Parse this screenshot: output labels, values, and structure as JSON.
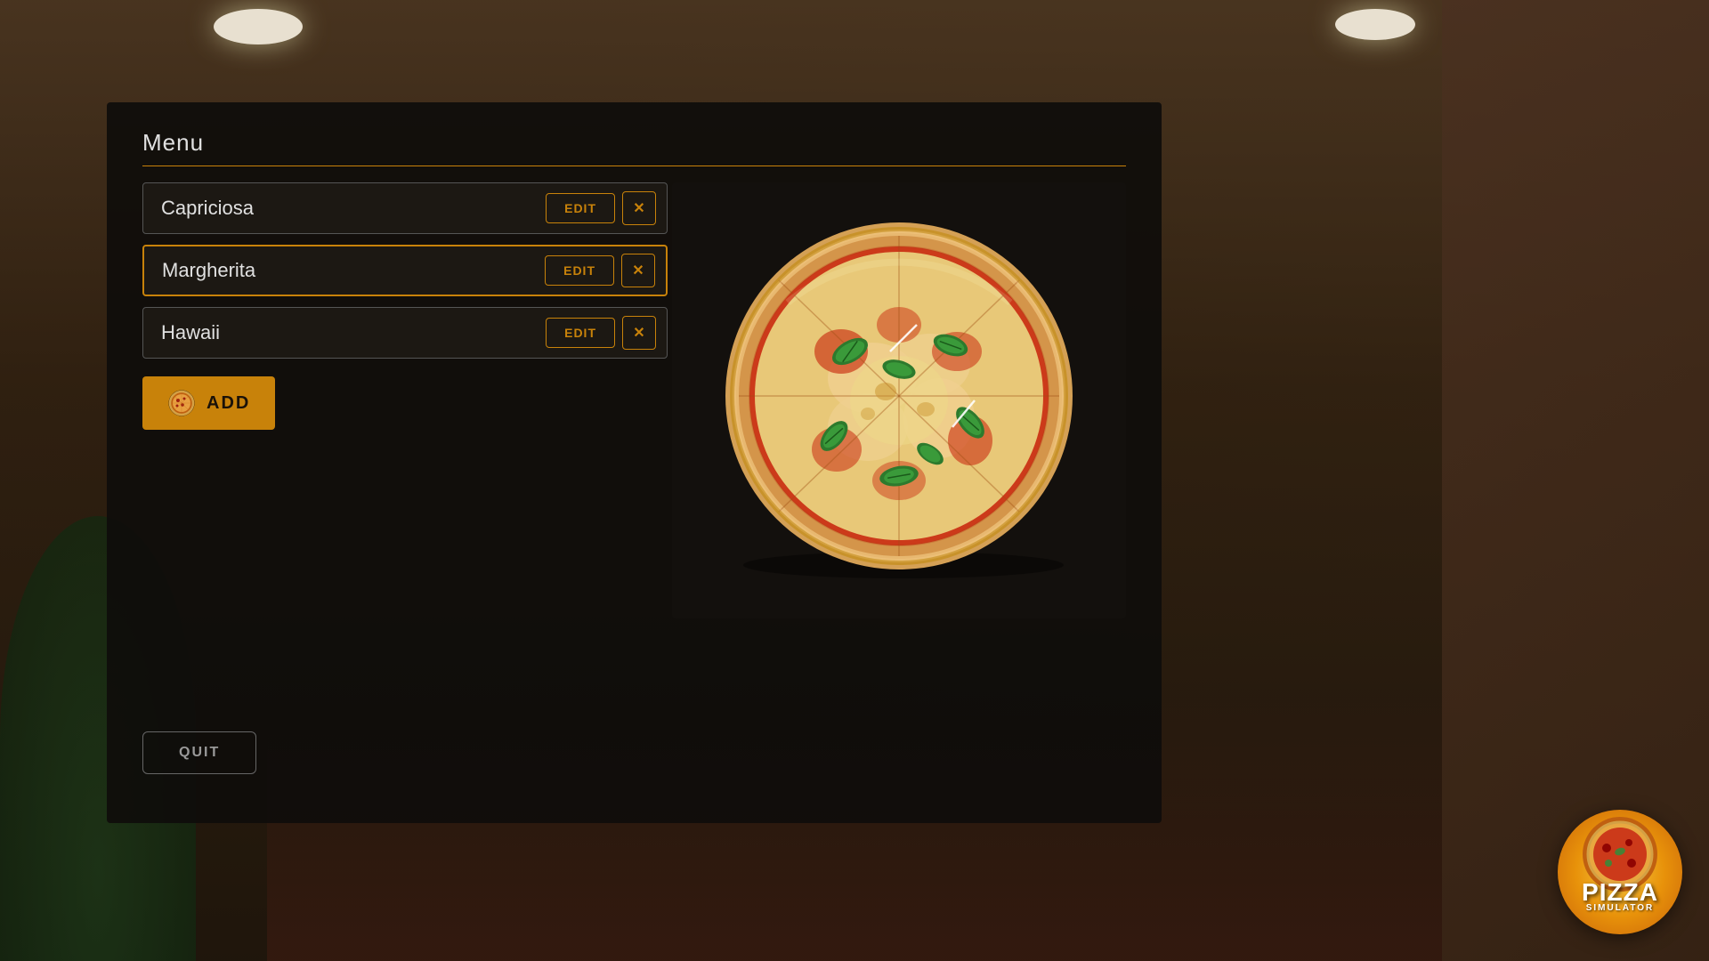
{
  "background": {
    "color": "#3d2b1a"
  },
  "modal": {
    "title": "Menu",
    "divider_color": "#c8820a"
  },
  "menu_items": [
    {
      "id": "capriciosa",
      "name": "Capriciosa",
      "selected": false,
      "edit_label": "EDIT",
      "delete_label": "×"
    },
    {
      "id": "margherita",
      "name": "Margherita",
      "selected": true,
      "edit_label": "EDIT",
      "delete_label": "×"
    },
    {
      "id": "hawaii",
      "name": "Hawaii",
      "selected": false,
      "edit_label": "EDIT",
      "delete_label": "×"
    }
  ],
  "add_button": {
    "label": "ADD",
    "icon": "pizza-icon"
  },
  "quit_button": {
    "label": "QUIT"
  },
  "logo": {
    "line1": "PIZZA",
    "line2": "SIMULATOR"
  },
  "pizza_preview": {
    "selected_item": "Margherita"
  }
}
